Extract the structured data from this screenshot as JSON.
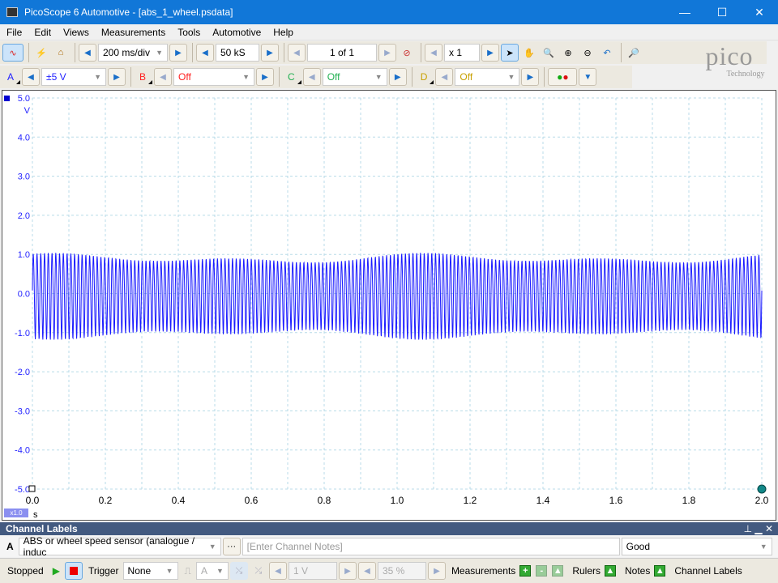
{
  "window": {
    "title": "PicoScope 6 Automotive - [abs_1_wheel.psdata]",
    "minimize": "—",
    "maximize": "☐",
    "close": "✕"
  },
  "menu": [
    "File",
    "Edit",
    "Views",
    "Measurements",
    "Tools",
    "Automotive",
    "Help"
  ],
  "toolbar": {
    "timebase": "200 ms/div",
    "samples": "50 kS",
    "buffer": "1 of 1",
    "zoom": "x 1"
  },
  "channels": [
    {
      "letter": "A",
      "range": "±5 V",
      "color": "#2323ff"
    },
    {
      "letter": "B",
      "range": "Off",
      "color": "#ff2020"
    },
    {
      "letter": "C",
      "range": "Off",
      "color": "#20b050"
    },
    {
      "letter": "D",
      "range": "Off",
      "color": "#c8a000"
    }
  ],
  "logo": {
    "name": "pico",
    "sub": "Technology"
  },
  "chart_data": {
    "type": "line",
    "xlabel": "s",
    "ylabel": "V",
    "xlim": [
      0,
      2
    ],
    "ylim": [
      -5,
      5
    ],
    "xticks": [
      "0.0",
      "0.2",
      "0.4",
      "0.6",
      "0.8",
      "1.0",
      "1.2",
      "1.4",
      "1.6",
      "1.8",
      "2.0"
    ],
    "yticks": [
      "5.0",
      "4.0",
      "3.0",
      "2.0",
      "1.0",
      "0.0",
      "-1.0",
      "-2.0",
      "-3.0",
      "-4.0",
      "-5.0"
    ],
    "grid": true,
    "zoom_badge": "x1.0",
    "series": [
      {
        "channel": "A",
        "color": "#1a1aff",
        "frequency_hz": 97,
        "amplitude_v": [
          0.8,
          1.1
        ],
        "offset_v": 0
      }
    ]
  },
  "channel_labels": {
    "title": "Channel Labels",
    "channel": "A",
    "label": "ABS or wheel speed sensor (analogue / induc",
    "more": "···",
    "notes_placeholder": "[Enter Channel Notes]",
    "quality": "Good"
  },
  "statusbar": {
    "state": "Stopped",
    "trigger_label": "Trigger",
    "trigger_mode": "None",
    "trigger_channel": "A",
    "threshold": "1 V",
    "pretrigger": "35 %",
    "measurements": "Measurements",
    "rulers": "Rulers",
    "notes": "Notes",
    "channel_labels": "Channel Labels"
  }
}
